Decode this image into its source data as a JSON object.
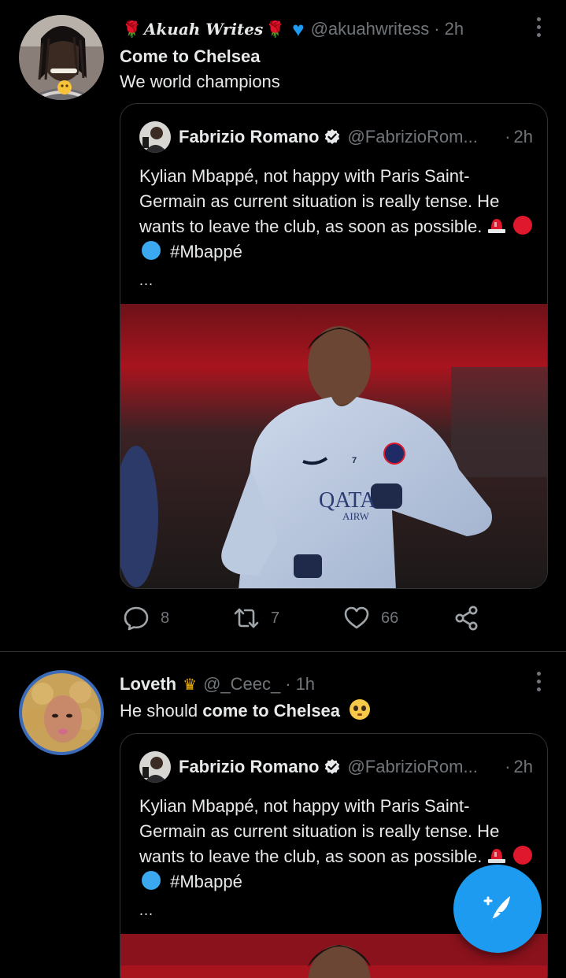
{
  "tweets": [
    {
      "display_name": "Akuah Writes",
      "handle": "@akuahwritess",
      "time": "2h",
      "text_line1": "Come to Chelsea",
      "text_line2": "We world champions",
      "quoted": {
        "display_name": "Fabrizio Romano",
        "handle": "@FabrizioRom...",
        "time": "2h",
        "text": "Kylian Mbappé, not happy with Paris Saint-Germain as current situation is really tense. He wants to leave the club, as soon as possible.",
        "hashtag": "#Mbappé",
        "ellipsis": "...",
        "media_shirt_number": "7",
        "media_sponsor": "QATA",
        "media_sponsor_sub": "AIRW"
      },
      "replies": "8",
      "retweets": "7",
      "likes": "66"
    },
    {
      "display_name": "Loveth",
      "handle": "@_Ceec_",
      "time": "1h",
      "text_plain": "He should ",
      "text_bold": "come to Chelsea",
      "text_emoji": "🥺",
      "quoted": {
        "display_name": "Fabrizio Romano",
        "handle": "@FabrizioRom...",
        "time": "2h",
        "text": "Kylian Mbappé, not happy with Paris Saint-Germain as current situation is really tense. He wants to leave the club, as soon as possible.",
        "hashtag": "#Mbappé",
        "ellipsis": "..."
      }
    }
  ],
  "separator_dot": "·",
  "colors": {
    "accent": "#1d9bf0",
    "secondary_text": "#71767b",
    "psg_red": "#e0182d",
    "psg_blue": "#3ba8f0"
  },
  "icons": {
    "reply": "reply-icon",
    "retweet": "retweet-icon",
    "like": "heart-icon",
    "share": "share-icon",
    "compose": "compose-tweet-icon",
    "more": "more-icon",
    "verified": "verified-badge-icon"
  }
}
